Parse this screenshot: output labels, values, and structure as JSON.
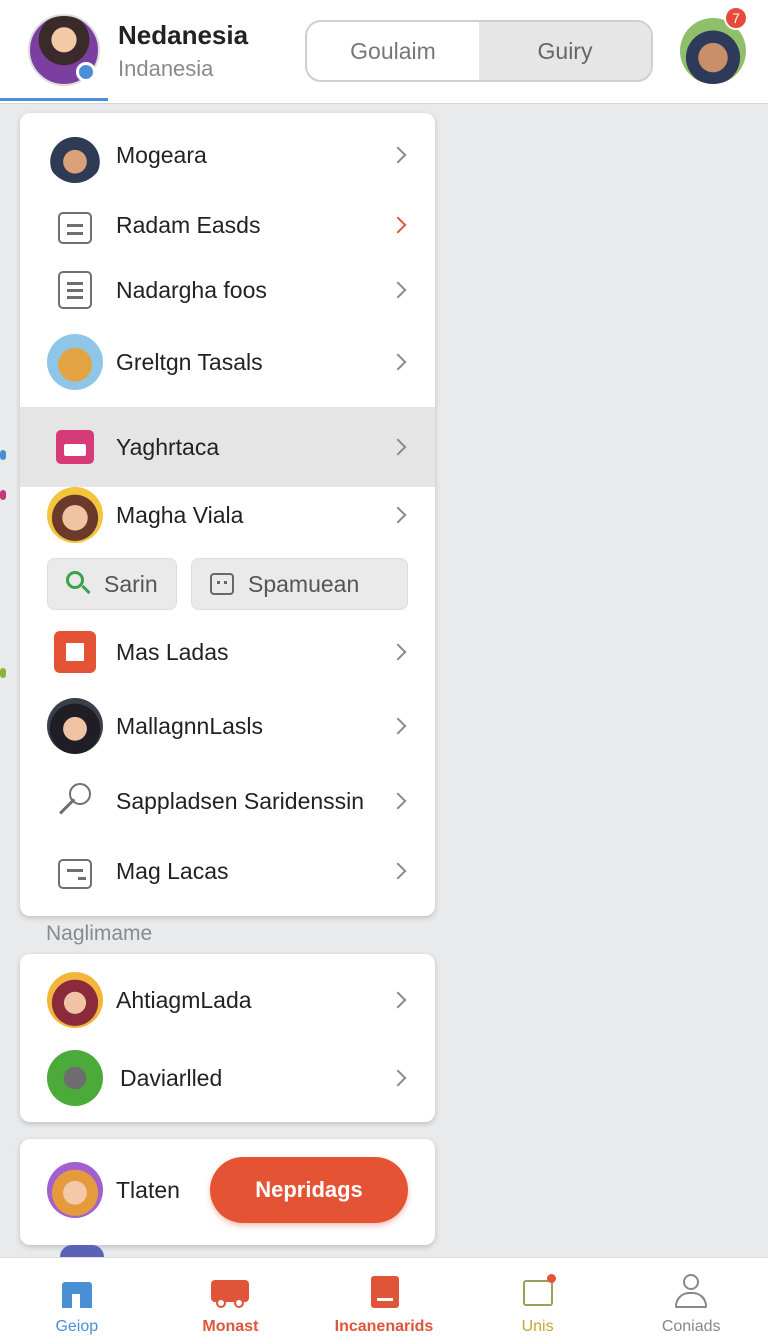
{
  "colors": {
    "accent": "#e55335",
    "link": "#4a8fd6",
    "card": "#ffffff",
    "background": "#e8eaec",
    "highlight_row": "#e5e5e5"
  },
  "header": {
    "name": "Nedanesia",
    "subtitle": "Indanesia",
    "segments": [
      "Goulaim",
      "Guiry"
    ],
    "active_segment": "Guiry",
    "notification_count": "7"
  },
  "menu": {
    "items": [
      {
        "label": "Mogeara",
        "icon": "avatar-character-icon"
      },
      {
        "label": "Radam Easds",
        "icon": "briefcase-icon"
      },
      {
        "label": "Nadargha foos",
        "icon": "document-icon"
      },
      {
        "label": "Greltgn Tasals",
        "icon": "avatar-camel-icon"
      },
      {
        "label": "Yaghrtaca",
        "icon": "store-icon"
      },
      {
        "label": "Magha Viala",
        "icon": "avatar-girl-icon"
      },
      {
        "label": "Mas Ladas",
        "icon": "red-box-icon"
      },
      {
        "label": "MallagnnLasls",
        "icon": "avatar-dark-icon"
      },
      {
        "label": "Sappladsen Saridenssin",
        "icon": "key-icon"
      },
      {
        "label": "Mag Lacas",
        "icon": "cabinet-icon"
      }
    ],
    "chips": [
      {
        "label": "Sarin",
        "icon": "search-icon"
      },
      {
        "label": "Spamuean",
        "icon": "calendar-icon"
      }
    ]
  },
  "section": {
    "label": "Naglimame",
    "items": [
      {
        "label": "AhtiagmLada",
        "icon": "avatar-gear-icon"
      },
      {
        "label": "Daviarlled",
        "icon": "avatar-robot-icon"
      }
    ]
  },
  "promo": {
    "label": "Tlaten",
    "button": "Nepridags"
  },
  "bottom_nav": [
    {
      "label": "Geiop",
      "color": "#4a8fd6",
      "icon": "home-icon"
    },
    {
      "label": "Monast",
      "color": "#e0553a",
      "icon": "truck-icon"
    },
    {
      "label": "Incanenarids",
      "color": "#e0553a",
      "icon": "book-icon"
    },
    {
      "label": "Unis",
      "color": "#c9a532",
      "icon": "mail-icon"
    },
    {
      "label": "Coniads",
      "color": "#888888",
      "icon": "person-icon"
    }
  ]
}
